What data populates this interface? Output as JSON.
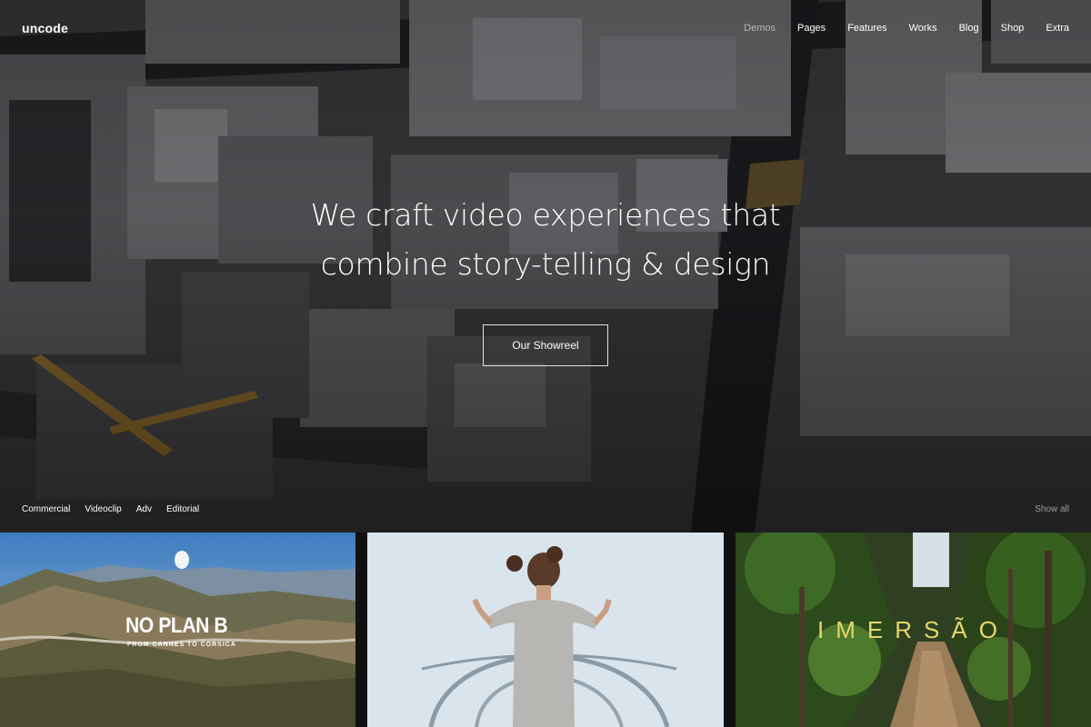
{
  "header": {
    "logo": "uncode",
    "menu": [
      {
        "label": "Demos",
        "active": true
      },
      {
        "label": "Pages",
        "active": false
      },
      {
        "label": "Features",
        "active": false
      },
      {
        "label": "Works",
        "active": false
      },
      {
        "label": "Blog",
        "active": false
      },
      {
        "label": "Shop",
        "active": false
      },
      {
        "label": "Extra",
        "active": false
      }
    ]
  },
  "hero": {
    "headline_line1": "We craft video experiences that",
    "headline_line2": "combine story-telling & design",
    "cta_label": "Our Showreel"
  },
  "filters": {
    "items": [
      "Commercial",
      "Videoclip",
      "Adv",
      "Editorial"
    ],
    "show_all": "Show all"
  },
  "portfolio": {
    "items": [
      {
        "title": "NO PLAN B",
        "subtitle": "FROM CANNES TO CORSICA"
      },
      {
        "title": ""
      },
      {
        "title": "IMERSÃO"
      }
    ]
  },
  "colors": {
    "accent_title": "#e6d86a",
    "menu_inactive": "#ffffff",
    "menu_active": "#8c8c8c"
  }
}
